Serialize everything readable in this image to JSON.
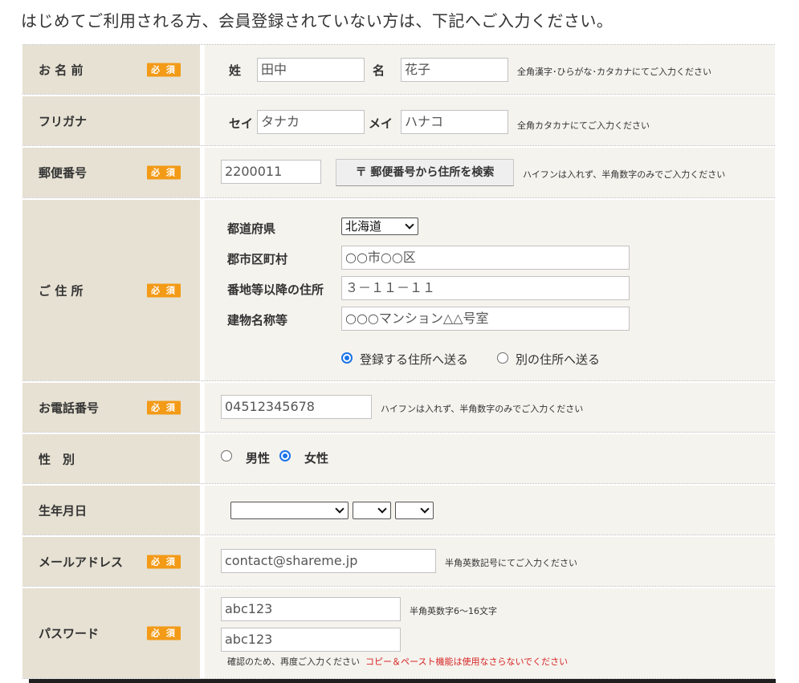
{
  "heading": "はじめてご利用される方、会員登録されていない方は、下記へご入力ください。",
  "required_badge": "必 須",
  "name": {
    "label": "お 名 前",
    "sei_label": "姓",
    "sei_value": "田中",
    "mei_label": "名",
    "mei_value": "花子",
    "note": "全角漢字･ひらがな･カタカナにてご入力ください"
  },
  "furigana": {
    "label": "フリガナ",
    "sei_label": "セイ",
    "sei_value": "タナカ",
    "mei_label": "メイ",
    "mei_value": "ハナコ",
    "note": "全角カタカナにてご入力ください"
  },
  "postal": {
    "label": "郵便番号",
    "value": "2200011",
    "search_button": "〒 郵便番号から住所を検索",
    "note": "ハイフンは入れず、半角数字のみでご入力ください"
  },
  "address": {
    "label": "ご 住 所",
    "prefecture_label": "都道府県",
    "prefecture_value": "北海道",
    "city_label": "郡市区町村",
    "city_value": "○○市○○区",
    "street_label": "番地等以降の住所",
    "street_value": "３－１１－１１",
    "building_label": "建物名称等",
    "building_value": "○○○マンション△△号室",
    "ship_registered": "登録する住所へ送る",
    "ship_other": "別の住所へ送る",
    "ship_selected": "registered"
  },
  "phone": {
    "label": "お電話番号",
    "value": "04512345678",
    "note": "ハイフンは入れず、半角数字のみでご入力ください"
  },
  "gender": {
    "label": "性　別",
    "male": "男性",
    "female": "女性",
    "selected": "female"
  },
  "birthday": {
    "label": "生年月日",
    "year": "",
    "month": "",
    "day": ""
  },
  "email": {
    "label": "メールアドレス",
    "value": "contact@shareme.jp",
    "note": "半角英数記号にてご入力ください"
  },
  "password": {
    "label": "パスワード",
    "value": "abc123",
    "confirm_value": "abc123",
    "note": "半角英数字6〜16文字",
    "confirm_note": "確認のため、再度ご入力ください",
    "warning": "コピー＆ペースト機能は使用なさらないでください"
  },
  "colors": {
    "label_bg": "#e6e1d3",
    "content_bg": "#f5f3ee",
    "required_badge": "#f39a17",
    "radio_selected": "#1a73e8",
    "warning_text": "#d62424"
  }
}
